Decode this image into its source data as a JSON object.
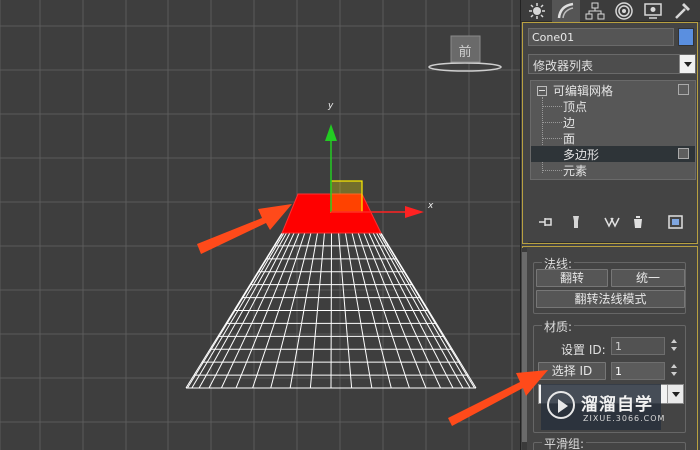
{
  "viewport": {
    "axis_y_label": "y",
    "axis_x_label": "x",
    "viewcube_face_label": "前"
  },
  "panel": {
    "tabs": [
      {
        "icon": "create-sun-icon"
      },
      {
        "icon": "modify-icon"
      },
      {
        "icon": "hierarchy-icon"
      },
      {
        "icon": "motion-icon"
      },
      {
        "icon": "display-icon"
      },
      {
        "icon": "utilities-hammer-icon"
      }
    ],
    "object_name": "Cone01",
    "object_color": "#5a8fe0",
    "modifier_list_label": "修改器列表",
    "stack": {
      "root": "可编辑网格",
      "items": [
        "顶点",
        "边",
        "面",
        "多边形",
        "元素"
      ],
      "selected": "多边形"
    },
    "normals": {
      "title": "法线:",
      "flip": "翻转",
      "unify": "统一",
      "flip_mode": "翻转法线模式"
    },
    "material": {
      "title": "材质:",
      "set_id_label": "设置 ID:",
      "set_id_value": "1",
      "select_id_button": "选择 ID",
      "select_id_value": "1"
    },
    "smoothing": {
      "title": "平滑组:"
    }
  },
  "watermark": {
    "title": "溜溜自学",
    "subtitle": "ZIXUE.3066.COM"
  },
  "colors": {
    "selected_faces": "#ff0000",
    "annotation_arrow": "#ff4a1a",
    "wireframe": "#ffffff",
    "gizmo_y": "#22cc22",
    "gizmo_x": "#ff2222",
    "gizmo_plane": "#ffee00"
  }
}
